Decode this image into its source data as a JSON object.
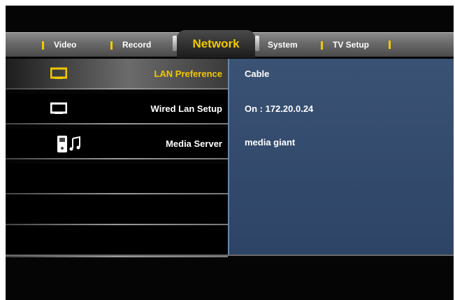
{
  "tabs": [
    {
      "label": "Video",
      "active": false
    },
    {
      "label": "Record",
      "active": false
    },
    {
      "label": "Network",
      "active": true
    },
    {
      "label": "System",
      "active": false
    },
    {
      "label": "TV Setup",
      "active": false
    }
  ],
  "menu": {
    "items": [
      {
        "label": "LAN Preference",
        "icon": "monitor-icon",
        "selected": true
      },
      {
        "label": "Wired Lan Setup",
        "icon": "monitor-icon",
        "selected": false
      },
      {
        "label": "Media Server",
        "icon": "media-server-icon",
        "selected": false
      }
    ]
  },
  "values": {
    "lan_preference": "Cable",
    "wired_lan_setup": "On : 172.20.0.24",
    "media_server": "media giant"
  },
  "colors": {
    "accent": "#f2c800",
    "panel": "#34496b",
    "text": "#ffffff"
  }
}
